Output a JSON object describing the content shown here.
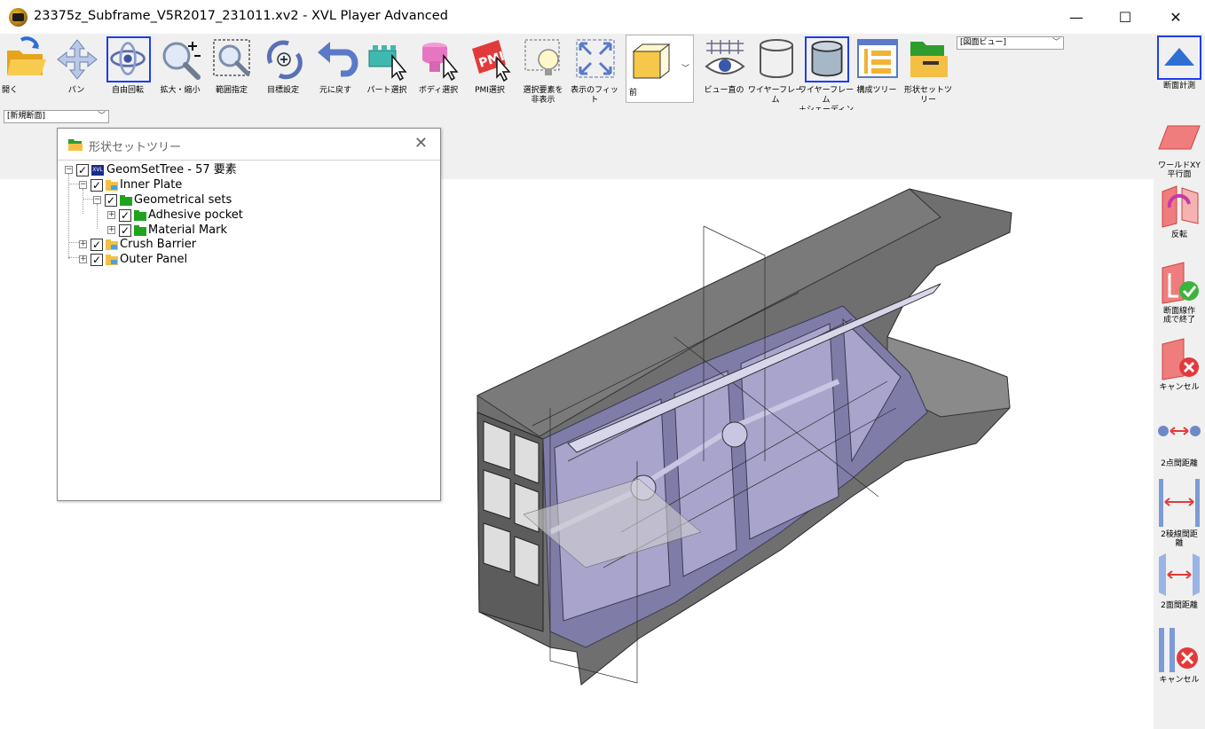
{
  "window": {
    "title": "23375z_Subframe_V5R2017_231011.xv2 - XVL Player Advanced",
    "minimize_glyph": "—",
    "maximize_glyph": "☐",
    "close_glyph": "✕"
  },
  "toolbar": {
    "open": "開く",
    "pan": "パン",
    "free_rotate": "自由回転",
    "zoom": "拡大・縮小",
    "range": "範囲指定",
    "target": "目標設定",
    "undo": "元に戻す",
    "part_select": "パート選択",
    "body_select": "ボディ選択",
    "pmi_select": "PMI選択",
    "hide_selected": "選択要素を\n非表示",
    "fit_view": "表示のフィッ\nト",
    "view_direction": "前",
    "view_straight": "ビュー直の",
    "wireframe": "ワイヤーフレーム",
    "wire_shading": "ワイヤーフレーム\n＋シェーディング",
    "structure_tree": "構成ツリー",
    "shape_set_tree": "形状セットツ\nリー",
    "drawing_view_select": "[図面ビュー]",
    "new_section_select": "[新規断面]"
  },
  "right_panel": {
    "section_measure": "断面計測",
    "world_xy": "ワールドXY\n平行面",
    "flip": "反転",
    "finish_section": "断面線作\n成で終了",
    "cancel": "キャンセル",
    "two_point_distance": "2点間距離",
    "two_line_distance": "2稜線間距\n離",
    "two_face_distance": "2面間距離",
    "cancel2": "キャンセル"
  },
  "tree": {
    "title": "形状セットツリー",
    "close_glyph": "✕",
    "expand_glyph": "+",
    "collapse_glyph": "−",
    "check_glyph": "✓",
    "xvl_badge": "XVL",
    "root": "GeomSetTree - 57 要素",
    "items": [
      {
        "label": "Inner Plate"
      },
      {
        "label": "Geometrical sets"
      },
      {
        "label": "Adhesive pocket"
      },
      {
        "label": "Material Mark"
      },
      {
        "label": "Crush Barrier"
      },
      {
        "label": "Outer Panel"
      }
    ]
  },
  "colors": {
    "accent": "#1e3cf0",
    "toolbar_bg": "#f0f0f0",
    "model_gray": "#6d6d6d",
    "model_purple": "#7e7ba8"
  }
}
